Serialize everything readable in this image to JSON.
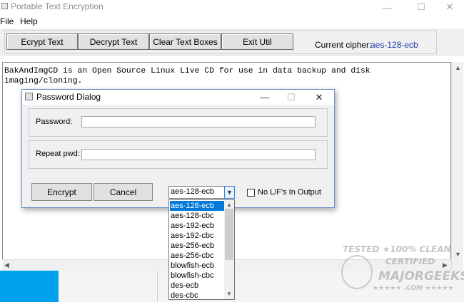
{
  "window": {
    "title": "Portable Text Encryption",
    "controls": {
      "minimize": "—",
      "maximize": "☐",
      "close": "✕"
    }
  },
  "menu": [
    "File",
    "Help"
  ],
  "toolbar": {
    "buttons": [
      "Ecrypt Text",
      "Decrypt Text",
      "Clear Text Boxes",
      "Exit Util"
    ],
    "cipher_label": "Current cipher:",
    "cipher_value": "aes-128-ecb"
  },
  "main_text": "BakAndImgCD is an Open Source Linux Live CD for use in data backup and disk imaging/cloning.",
  "dialog": {
    "title": "Password Dialog",
    "controls": {
      "minimize": "—",
      "maximize": "☐",
      "close": "✕"
    },
    "password_label": "Password:",
    "password_value": "",
    "repeat_label": "Repeat pwd:",
    "repeat_value": "",
    "encrypt_button": "Encrypt",
    "cancel_button": "Cancel",
    "cipher_selected": "aes-128-ecb",
    "no_lf_label": "No L/F's In Output",
    "no_lf_checked": false
  },
  "cipher_options": [
    "aes-128-ecb",
    "aes-128-cbc",
    "aes-192-ecb",
    "aes-192-cbc",
    "aes-256-ecb",
    "aes-256-cbc",
    "blowfish-ecb",
    "blowfish-cbc",
    "des-ecb",
    "des-cbc"
  ],
  "watermark": {
    "line1": "TESTED ★100% CLEAN",
    "line2": "CERTIFIED",
    "line3": "MAJORGEEKS",
    "line4": "★★★★★ .COM ★★★★★"
  },
  "colors": {
    "accent_blue": "#0078d7",
    "cipher_text": "#1a3ea8",
    "taskbar_blue": "#00a2ed",
    "dialog_border": "#6b8fc4"
  }
}
